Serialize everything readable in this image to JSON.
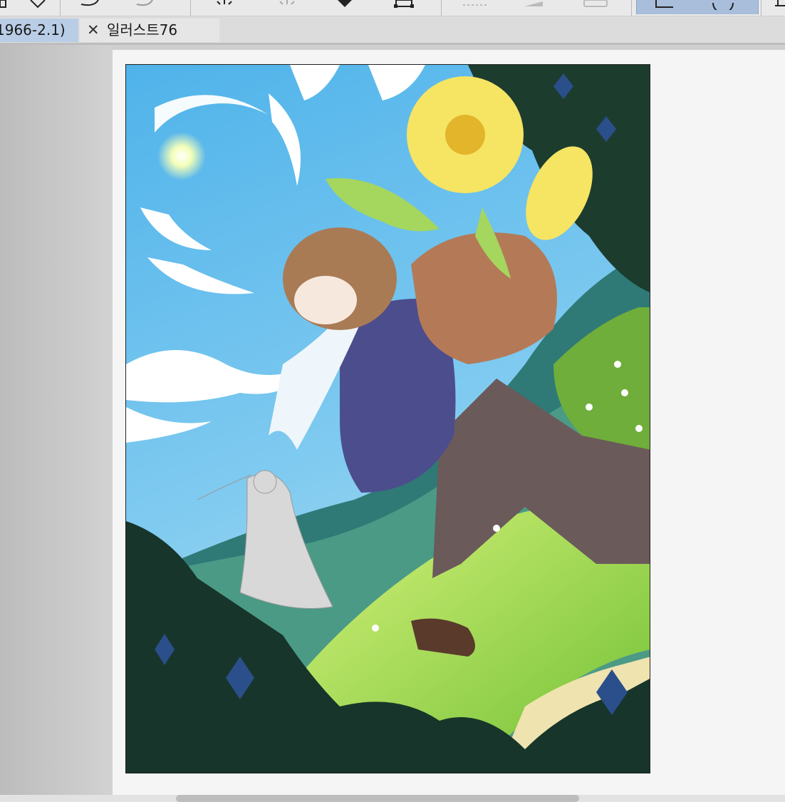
{
  "tabs": [
    {
      "label": "1966-2.1)",
      "active": true
    },
    {
      "label": "일러스트76",
      "close_label": "✕",
      "active": false
    }
  ],
  "toolbar": {
    "icons": [
      "pen-tool-icon",
      "eraser-icon",
      "blend-icon",
      "lasso-icon",
      "magic-icon",
      "fill-icon",
      "transform-icon",
      "grid-icon",
      "gradient-icon",
      "keyboard-icon",
      "selection-tool-icon",
      "circle-tool-icon",
      "more-icon"
    ],
    "active_color": "#a9bedb"
  },
  "canvas": {
    "artwork_description_colors": {
      "sky": "#6ec2ee",
      "foliage": "#17352a",
      "grass": "#a8e04c",
      "sunflower": "#f7e45a"
    }
  }
}
